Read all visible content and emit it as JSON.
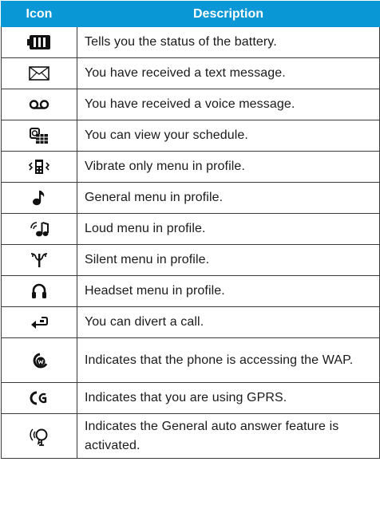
{
  "table": {
    "headers": {
      "icon": "Icon",
      "description": "Description"
    },
    "rows": [
      {
        "icon": "battery-icon",
        "description": "Tells you the status of the battery."
      },
      {
        "icon": "envelope-icon",
        "description": "You have received a text message."
      },
      {
        "icon": "voicemail-icon",
        "description": "You have received a voice message."
      },
      {
        "icon": "schedule-icon",
        "description": "You can view your schedule."
      },
      {
        "icon": "vibrate-icon",
        "description": "Vibrate only menu in profile."
      },
      {
        "icon": "music-note-icon",
        "description": "General menu in profile."
      },
      {
        "icon": "loud-icon",
        "description": "Loud menu in profile."
      },
      {
        "icon": "silent-icon",
        "description": "Silent menu in profile."
      },
      {
        "icon": "headset-icon",
        "description": "Headset menu in profile."
      },
      {
        "icon": "call-divert-icon",
        "description": "You can divert a call."
      },
      {
        "icon": "wap-icon",
        "description": "Indicates that the phone is accessing the WAP."
      },
      {
        "icon": "gprs-icon",
        "description": "Indicates that you are using GPRS."
      },
      {
        "icon": "auto-answer-icon",
        "description": "Indicates the General auto answer feature is activated."
      }
    ]
  }
}
